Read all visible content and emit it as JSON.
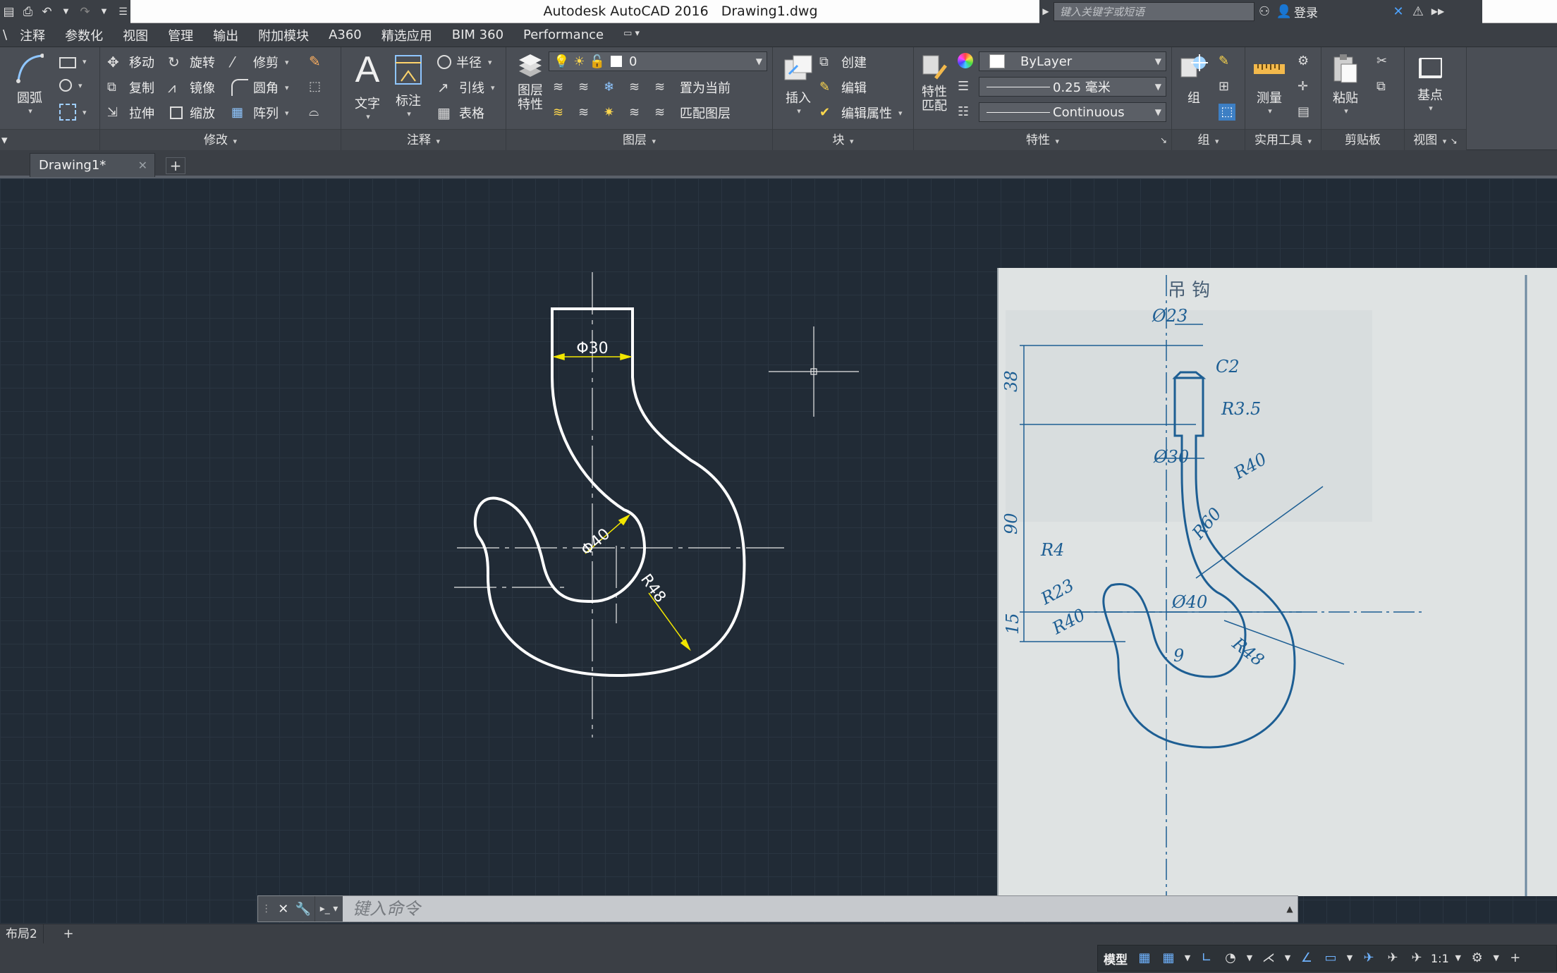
{
  "titlebar": {
    "app_title": "Autodesk AutoCAD 2016",
    "file_name": "Drawing1.dwg",
    "search_placeholder": "键入关键字或短语",
    "login_label": "登录"
  },
  "menu_tabs": [
    "注释",
    "参数化",
    "视图",
    "管理",
    "输出",
    "附加模块",
    "A360",
    "精选应用",
    "BIM 360",
    "Performance"
  ],
  "ribbon": {
    "draw": {
      "arc_label": "圆弧"
    },
    "modify": {
      "title": "修改",
      "items": [
        "移动",
        "旋转",
        "修剪",
        "复制",
        "镜像",
        "圆角",
        "拉伸",
        "缩放",
        "阵列"
      ]
    },
    "annotation": {
      "title": "注释",
      "text_label": "文字",
      "dimension_label": "标注",
      "items": [
        "半径",
        "引线",
        "表格"
      ]
    },
    "layers": {
      "title": "图层",
      "layer_props_label": "图层\n特性",
      "current_layer": "0",
      "set_current_label": "置为当前",
      "match_layer_label": "匹配图层"
    },
    "block": {
      "title": "块",
      "insert_label": "插入",
      "create_label": "创建",
      "edit_label": "编辑",
      "edit_attr_label": "编辑属性"
    },
    "properties": {
      "title": "特性",
      "match_label": "特性\n匹配",
      "color": "ByLayer",
      "lineweight": "0.25 毫米",
      "linetype": "Continuous"
    },
    "group": {
      "title": "组",
      "group_label": "组"
    },
    "utilities": {
      "title": "实用工具",
      "measure_label": "测量"
    },
    "clipboard": {
      "title": "剪贴板",
      "paste_label": "粘贴"
    },
    "view": {
      "title": "视图",
      "basepoint_label": "基点"
    }
  },
  "document_tab": {
    "label": "Drawing1*"
  },
  "drawing": {
    "dim_top": "Φ30",
    "dim_hole": "Φ40",
    "dim_outer": "R48"
  },
  "reference": {
    "title": "吊 钩",
    "labels": [
      "Ø23",
      "C2",
      "R3.5",
      "38",
      "Ø30",
      "R40",
      "90",
      "R60",
      "R4",
      "R23",
      "Ø40",
      "R40",
      "15",
      "R48",
      "9"
    ]
  },
  "command": {
    "placeholder": "键入命令"
  },
  "layout": {
    "tab_label": "布局2"
  },
  "status": {
    "model_label": "模型",
    "scale": "1:1"
  },
  "colors": {
    "canvas": "#212b36",
    "dim_yellow": "#f2e600",
    "ref_blue": "#1d5e93"
  }
}
